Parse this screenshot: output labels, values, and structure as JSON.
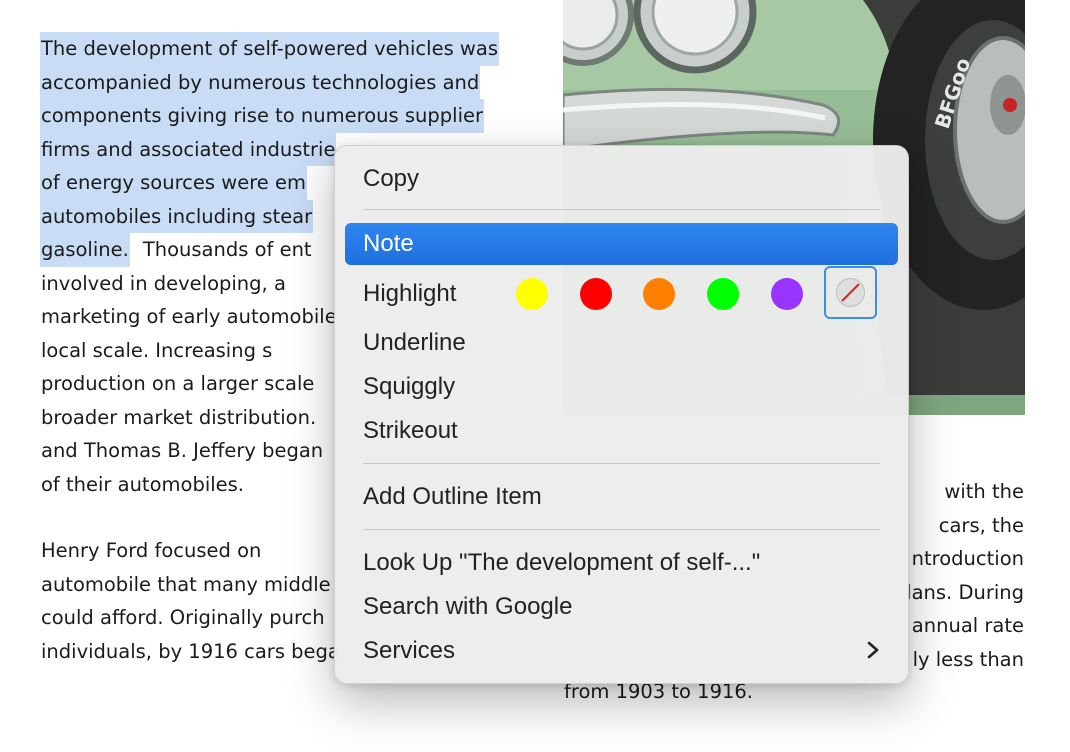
{
  "document": {
    "left_paragraph_1_lines": [
      "The development of self-powered vehicles was",
      "accompanied by numerous technologies and",
      "components giving rise to numerous supplier",
      "firms and associated industrie",
      "of energy sources were em",
      "automobiles including stear",
      "gasoline.",
      "Thousands of ent",
      "involved in developing, a",
      "marketing of early automobile",
      "local scale. Increasing s",
      "production on a larger scale",
      "broader market distribution.",
      "and Thomas B. Jeffery began",
      "of their automobiles."
    ],
    "left_paragraph_2_lines": [
      "Henry Ford focused on",
      "automobile that many middle",
      "could afford. Originally purch",
      "individuals, by 1916 cars bega"
    ],
    "right_paragraph_lines": [
      "with the",
      "cars, the",
      "ntroduction",
      "lans. During",
      "annual rate",
      "ly less than"
    ],
    "right_paragraph_tail": "from 1903 to 1916."
  },
  "photo": {
    "tire_lettering": "BFGoo"
  },
  "context_menu": {
    "copy": "Copy",
    "note": "Note",
    "highlight": "Highlight",
    "underline": "Underline",
    "squiggly": "Squiggly",
    "strikeout": "Strikeout",
    "add_outline_item": "Add Outline Item",
    "look_up": "Look Up \"The development of self-...\"",
    "search_google": "Search with Google",
    "services": "Services",
    "highlight_colors": [
      "#ffff00",
      "#ff0000",
      "#ff8000",
      "#00ff00",
      "#9933ff"
    ],
    "active_color": "#1f6fde"
  }
}
